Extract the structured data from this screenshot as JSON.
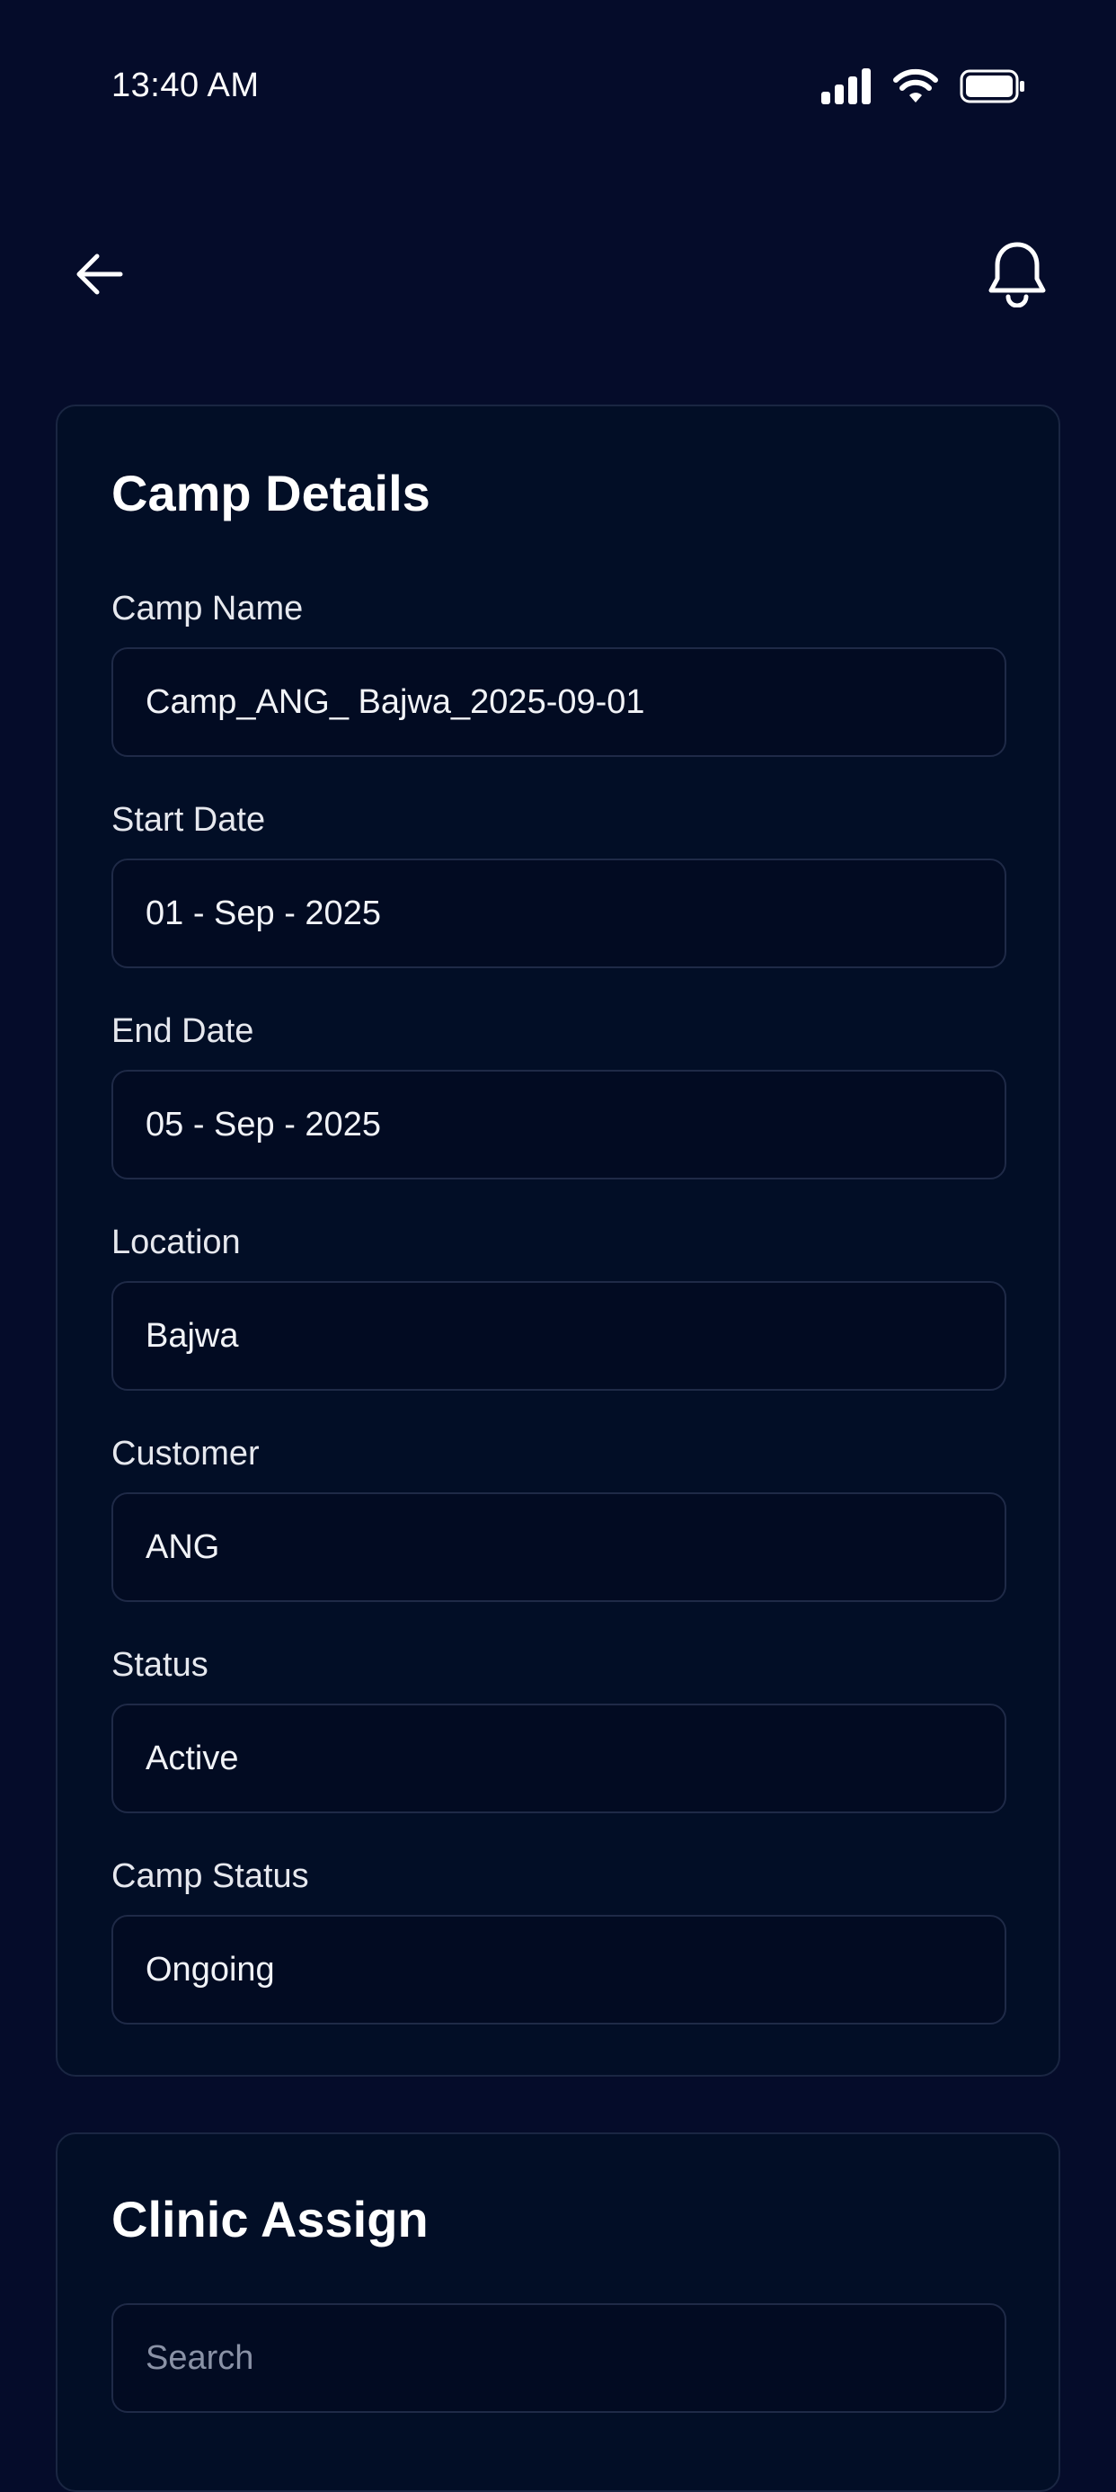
{
  "status_bar": {
    "time": "13:40 AM"
  },
  "header": {
    "back_icon": "arrow-left-icon",
    "bell_icon": "bell-icon"
  },
  "camp_details": {
    "title": "Camp Details",
    "fields": [
      {
        "label": "Camp Name",
        "value": "Camp_ANG_ Bajwa_2025-09-01"
      },
      {
        "label": "Start Date",
        "value": "01 - Sep - 2025"
      },
      {
        "label": "End Date",
        "value": "05 - Sep - 2025"
      },
      {
        "label": "Location",
        "value": "Bajwa"
      },
      {
        "label": "Customer",
        "value": "ANG"
      },
      {
        "label": "Status",
        "value": "Active"
      },
      {
        "label": "Camp Status",
        "value": "Ongoing"
      }
    ]
  },
  "clinic_assign": {
    "title": "Clinic Assign",
    "search_placeholder": "Search"
  },
  "colors": {
    "background": "#050c2a",
    "card": "#020e26",
    "border": "#1a2642",
    "text": "#ffffff",
    "placeholder": "#8a92a6"
  }
}
